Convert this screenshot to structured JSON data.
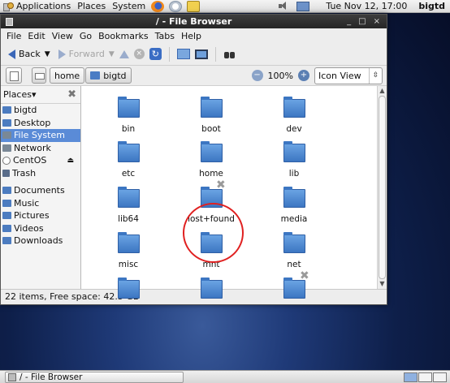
{
  "top_panel": {
    "menus": [
      "Applications",
      "Places",
      "System"
    ],
    "launchers": [
      "firefox-icon",
      "mail-icon",
      "notes-icon"
    ],
    "clock": "Tue Nov 12, 17:00",
    "user": "bigtd"
  },
  "window": {
    "title": "/ - File Browser",
    "title_buttons": [
      "_",
      "□",
      "×"
    ],
    "menus": [
      "File",
      "Edit",
      "View",
      "Go",
      "Bookmarks",
      "Tabs",
      "Help"
    ],
    "toolbar": {
      "back": "Back",
      "forward": "Forward"
    },
    "location": {
      "crumbs": [
        "home",
        "bigtd"
      ],
      "zoom": "100%",
      "view_mode": "Icon View"
    },
    "sidebar": {
      "header": "Places",
      "items_top": [
        "bigtd",
        "Desktop",
        "File System",
        "Network",
        "CentOS",
        "Trash"
      ],
      "items_bottom": [
        "Documents",
        "Music",
        "Pictures",
        "Videos",
        "Downloads"
      ],
      "selected": "File System"
    },
    "files": [
      "bin",
      "boot",
      "dev",
      "etc",
      "home",
      "lib",
      "lib64",
      "lost+found",
      "media",
      "misc",
      "mnt",
      "net"
    ],
    "status": "22 items, Free space: 42.5 GB"
  },
  "bottom_panel": {
    "task": "/ - File Browser"
  },
  "colors": {
    "selection": "#5a8bd7",
    "folder": "#4a7cc4",
    "annotation_circle": "#e02020"
  }
}
